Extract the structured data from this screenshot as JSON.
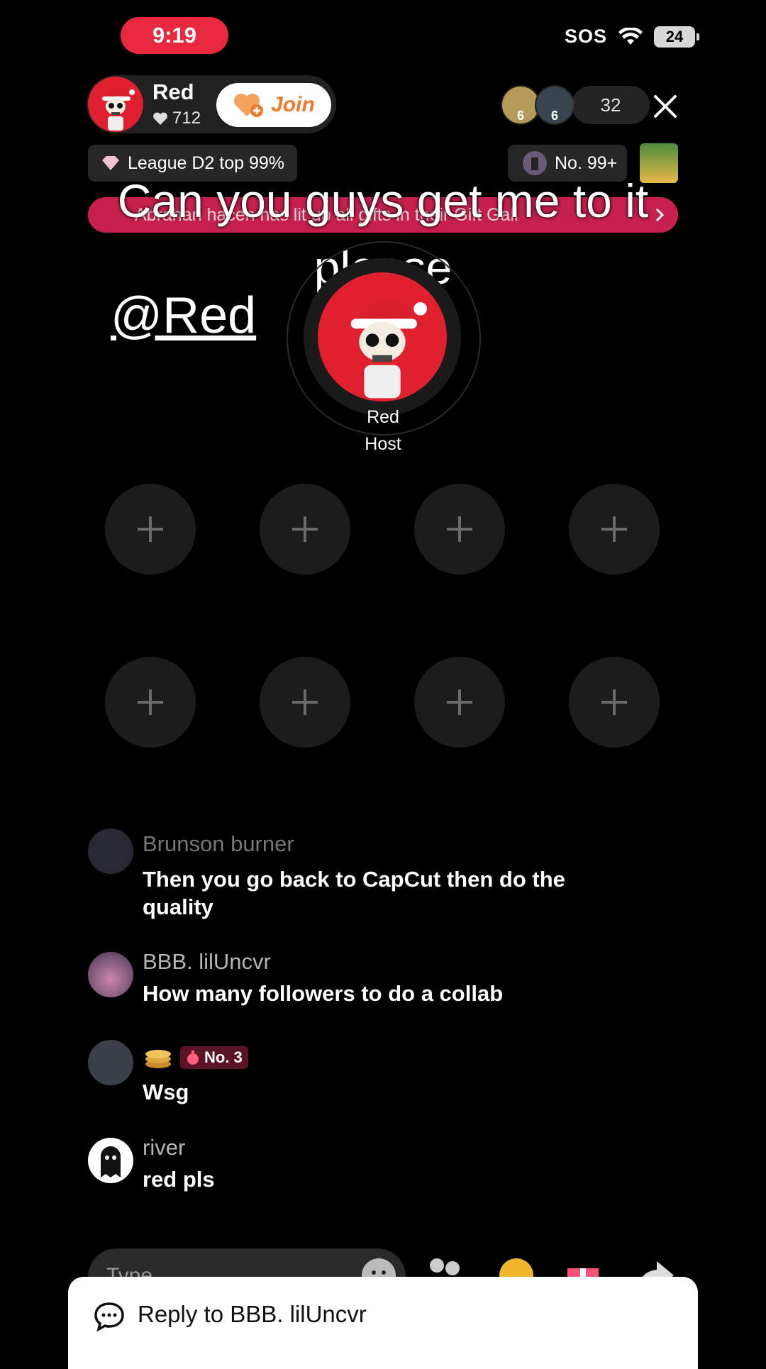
{
  "status_bar": {
    "time": "9:19",
    "sos": "SOS",
    "battery": "24"
  },
  "host": {
    "name": "Red",
    "likes": "712",
    "join_label": "Join"
  },
  "viewers": {
    "count": "32",
    "badges": [
      "6",
      "6"
    ]
  },
  "league": {
    "label": "League D2 top 99%"
  },
  "rank": {
    "label": "No. 99+"
  },
  "banner": {
    "text": "Abrahan  hacen  has lit up all gifts in their Gift Gall"
  },
  "overlay": {
    "caption": "Can you guys get me to it please",
    "mention": "@Red"
  },
  "center_host": {
    "name": "Red",
    "role": "Host"
  },
  "seats": {
    "count": 8
  },
  "chat": [
    {
      "user": "Brunson burner",
      "message": "Then you go back to CapCut then do the quality"
    },
    {
      "user": "BBB. lilUncvr",
      "message": "How many followers to do a collab"
    },
    {
      "user": "",
      "badge": "No. 3",
      "message": "Wsg"
    },
    {
      "user": "river",
      "message": "red pls"
    }
  ],
  "input": {
    "placeholder": "Type..."
  },
  "reply": {
    "label": "Reply to BBB. lilUncvr"
  },
  "colors": {
    "accent": "#e8283e",
    "banner": "#c8204e",
    "join": "#f07a2c"
  }
}
